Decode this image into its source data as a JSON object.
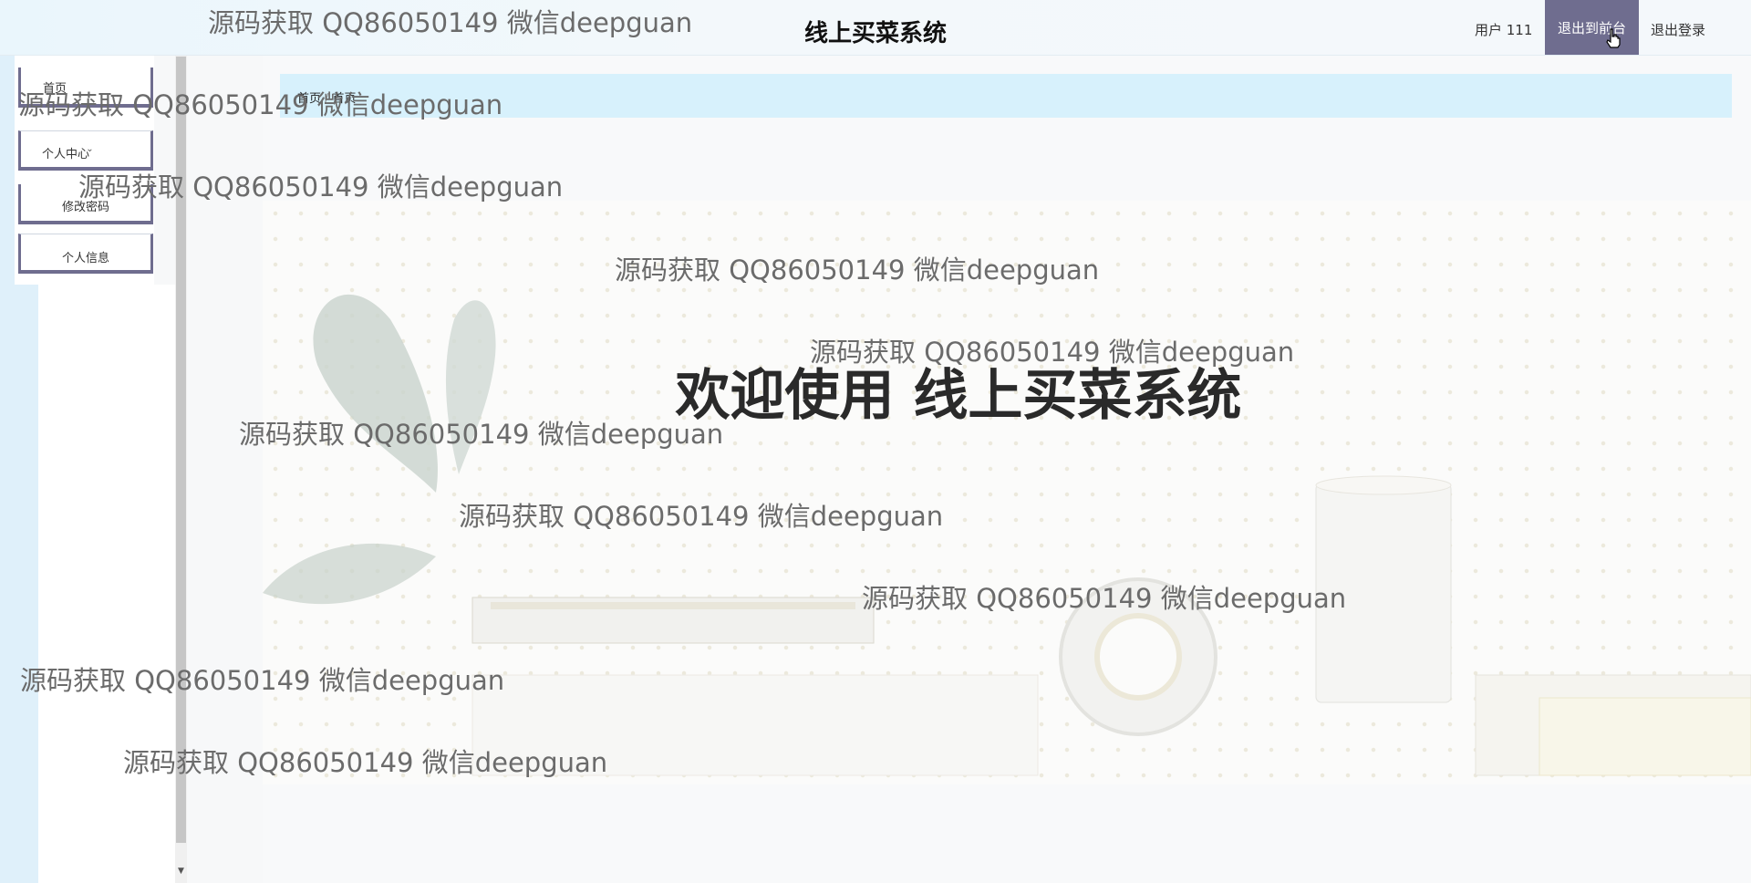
{
  "header": {
    "title": "线上买菜系统",
    "user_label": "用户 111",
    "front_button": "退出到前台",
    "logout_button": "退出登录",
    "accent_color": "#6f6d8f"
  },
  "sidebar": {
    "items": [
      {
        "label": "首页"
      },
      {
        "label": "个人中心",
        "icon": "chevron-down-icon"
      },
      {
        "label": "修改密码"
      },
      {
        "label": "个人信息"
      }
    ]
  },
  "breadcrumb": {
    "items": [
      "首页",
      "首页"
    ],
    "separator": "/"
  },
  "main": {
    "welcome": "欢迎使用 线上买菜系统"
  },
  "watermark": {
    "text": "源码获取 QQ86050149 微信deepguan"
  }
}
